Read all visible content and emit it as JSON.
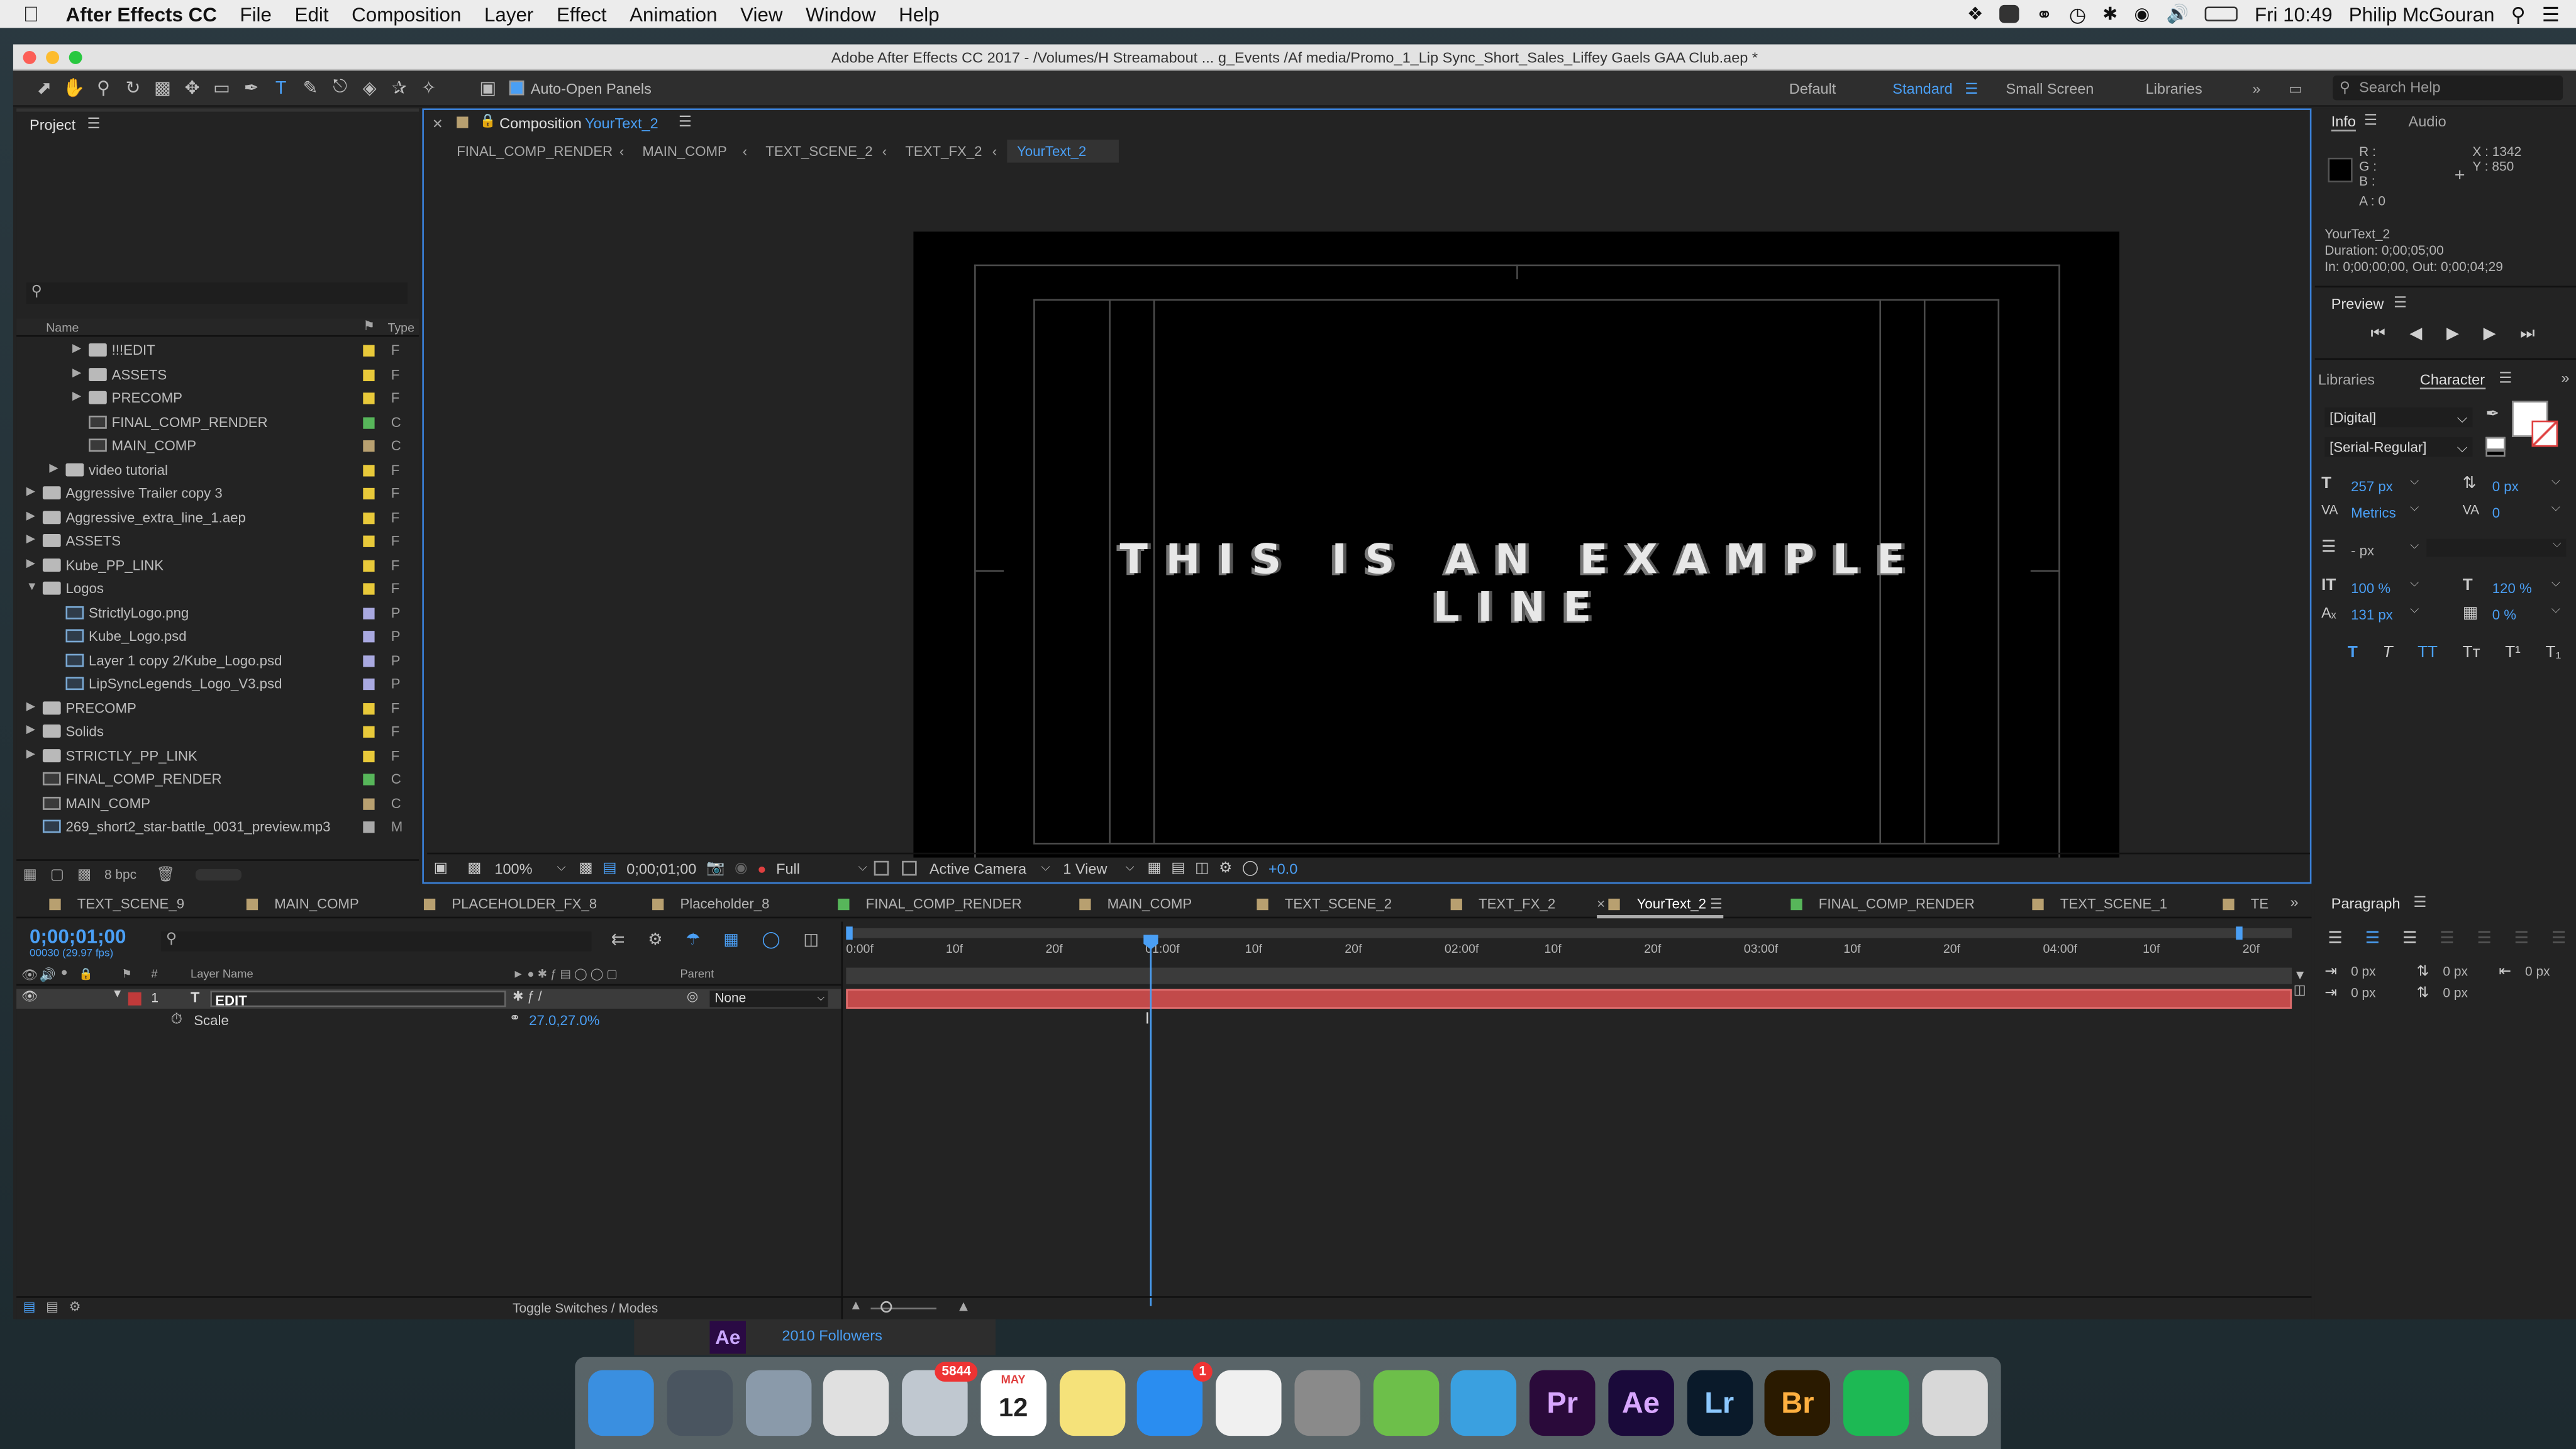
{
  "menubar": {
    "app": "After Effects CC",
    "items": [
      "File",
      "Edit",
      "Composition",
      "Layer",
      "Effect",
      "Animation",
      "View",
      "Window",
      "Help"
    ],
    "time": "Fri 10:49",
    "user": "Philip McGouran"
  },
  "window": {
    "title": "Adobe After Effects CC 2017 - /Volumes/H Streamabout ... g_Events /Af media/Promo_1_Lip Sync_Short_Sales_Liffey Gaels GAA Club.aep *"
  },
  "toolbar": {
    "auto_open": "Auto-Open Panels",
    "workspaces": [
      "Default",
      "Standard",
      "Small Screen",
      "Libraries"
    ],
    "current_workspace": "Standard",
    "search_placeholder": "Search Help"
  },
  "project": {
    "title": "Project",
    "search_placeholder": "",
    "col_name": "Name",
    "col_type": "Type",
    "bpc": "8 bpc",
    "items": [
      {
        "name": "!!!EDIT",
        "kind": "folder",
        "indent": 2,
        "tri": "▶",
        "color": "#e8c93a",
        "type": "F"
      },
      {
        "name": "ASSETS",
        "kind": "folder",
        "indent": 2,
        "tri": "▶",
        "color": "#e8c93a",
        "type": "F"
      },
      {
        "name": "PRECOMP",
        "kind": "folder",
        "indent": 2,
        "tri": "▶",
        "color": "#e8c93a",
        "type": "F"
      },
      {
        "name": "FINAL_COMP_RENDER",
        "kind": "comp",
        "indent": 2,
        "tri": "",
        "color": "#57b65a",
        "type": "C"
      },
      {
        "name": "MAIN_COMP",
        "kind": "comp",
        "indent": 2,
        "tri": "",
        "color": "#b8a070",
        "type": "C"
      },
      {
        "name": "video tutorial",
        "kind": "folder",
        "indent": 1,
        "tri": "▶",
        "color": "#e8c93a",
        "type": "F"
      },
      {
        "name": "Aggressive Trailer copy 3",
        "kind": "folder",
        "indent": 0,
        "tri": "▶",
        "color": "#e8c93a",
        "type": "F"
      },
      {
        "name": "Aggressive_extra_line_1.aep",
        "kind": "folder",
        "indent": 0,
        "tri": "▶",
        "color": "#e8c93a",
        "type": "F"
      },
      {
        "name": "ASSETS",
        "kind": "folder",
        "indent": 0,
        "tri": "▶",
        "color": "#e8c93a",
        "type": "F"
      },
      {
        "name": "Kube_PP_LINK",
        "kind": "folder",
        "indent": 0,
        "tri": "▶",
        "color": "#e8c93a",
        "type": "F"
      },
      {
        "name": "Logos",
        "kind": "folder",
        "indent": 0,
        "tri": "▼",
        "color": "#e8c93a",
        "type": "F"
      },
      {
        "name": "StrictlyLogo.png",
        "kind": "file",
        "indent": 1,
        "tri": "",
        "color": "#a9a9e0",
        "type": "P"
      },
      {
        "name": "Kube_Logo.psd",
        "kind": "file",
        "indent": 1,
        "tri": "",
        "color": "#a9a9e0",
        "type": "P"
      },
      {
        "name": "Layer 1 copy 2/Kube_Logo.psd",
        "kind": "file",
        "indent": 1,
        "tri": "",
        "color": "#a9a9e0",
        "type": "P"
      },
      {
        "name": "LipSyncLegends_Logo_V3.psd",
        "kind": "file",
        "indent": 1,
        "tri": "",
        "color": "#a9a9e0",
        "type": "P"
      },
      {
        "name": "PRECOMP",
        "kind": "folder",
        "indent": 0,
        "tri": "▶",
        "color": "#e8c93a",
        "type": "F"
      },
      {
        "name": "Solids",
        "kind": "folder",
        "indent": 0,
        "tri": "▶",
        "color": "#e8c93a",
        "type": "F"
      },
      {
        "name": "STRICTLY_PP_LINK",
        "kind": "folder",
        "indent": 0,
        "tri": "▶",
        "color": "#e8c93a",
        "type": "F"
      },
      {
        "name": "FINAL_COMP_RENDER",
        "kind": "comp",
        "indent": 0,
        "tri": "",
        "color": "#57b65a",
        "type": "C"
      },
      {
        "name": "MAIN_COMP",
        "kind": "comp",
        "indent": 0,
        "tri": "",
        "color": "#b8a070",
        "type": "C"
      },
      {
        "name": "269_short2_star-battle_0031_preview.mp3",
        "kind": "file",
        "indent": 0,
        "tri": "",
        "color": "#a9a9a9",
        "type": "M"
      }
    ]
  },
  "composition": {
    "tab_prefix": "Composition",
    "tab_name": "YourText_2",
    "breadcrumbs": [
      "FINAL_COMP_RENDER",
      "MAIN_COMP",
      "TEXT_SCENE_2",
      "TEXT_FX_2",
      "YourText_2"
    ],
    "canvas_text": "THIS IS AN EXAMPLE LINE",
    "zoom": "100%",
    "timecode": "0;00;01;00",
    "resolution": "Full",
    "camera": "Active Camera",
    "views": "1 View",
    "exposure": "+0.0"
  },
  "info": {
    "tab": "Info",
    "tab2": "Audio",
    "r": "R :",
    "g": "G :",
    "b": "B :",
    "a": "A : 0",
    "x": "X : 1342",
    "y": "Y : 850",
    "comp_name": "YourText_2",
    "duration": "Duration: 0;00;05;00",
    "inout": "In: 0;00;00;00, Out: 0;00;04;29"
  },
  "preview": {
    "title": "Preview"
  },
  "character": {
    "tab_lib": "Libraries",
    "tab": "Character",
    "font": "[Digital]",
    "style": "[Serial-Regular]",
    "size": "257 px",
    "leading": "0 px",
    "kerning": "Metrics",
    "tracking": "0",
    "stroke": "- px",
    "vscale": "100 %",
    "hscale": "120 %",
    "baseline": "131 px",
    "tsume": "0 %"
  },
  "paragraph": {
    "title": "Paragraph",
    "values": [
      "0 px",
      "0 px",
      "0 px",
      "0 px",
      "0 px"
    ]
  },
  "timeline": {
    "tabs": [
      {
        "name": "TEXT_SCENE_9",
        "color": "#b8a070"
      },
      {
        "name": "MAIN_COMP",
        "color": "#b8a070"
      },
      {
        "name": "PLACEHOLDER_FX_8",
        "color": "#b8a070"
      },
      {
        "name": "Placeholder_8",
        "color": "#b8a070"
      },
      {
        "name": "FINAL_COMP_RENDER",
        "color": "#57b65a"
      },
      {
        "name": "MAIN_COMP",
        "color": "#b8a070"
      },
      {
        "name": "TEXT_SCENE_2",
        "color": "#b8a070"
      },
      {
        "name": "TEXT_FX_2",
        "color": "#b8a070"
      },
      {
        "name": "YourText_2",
        "color": "#b8a070"
      },
      {
        "name": "FINAL_COMP_RENDER",
        "color": "#57b65a"
      },
      {
        "name": "TEXT_SCENE_1",
        "color": "#b8a070"
      },
      {
        "name": "TE",
        "color": "#b8a070"
      }
    ],
    "timecode": "0;00;01;00",
    "fps": "00030 (29.97 fps)",
    "search_placeholder": "",
    "col_layer": "Layer Name",
    "col_num": "#",
    "col_parent": "Parent",
    "layer": {
      "num": "1",
      "name": "EDIT",
      "parent": "None",
      "color": "#c03a3a"
    },
    "prop": {
      "name": "Scale",
      "value": "27.0,27.0%"
    },
    "ruler": [
      "0:00f",
      "10f",
      "20f",
      "01:00f",
      "10f",
      "20f",
      "02:00f",
      "10f",
      "20f",
      "03:00f",
      "10f",
      "20f",
      "04:00f",
      "10f",
      "20f"
    ],
    "toggle": "Toggle Switches / Modes",
    "playhead_fraction": 0.2
  },
  "notification": {
    "followers": "2010 Followers",
    "badge": "Ae"
  },
  "dock": {
    "items": [
      {
        "name": "finder",
        "label": "",
        "color": "#3a8fe0"
      },
      {
        "name": "preview",
        "label": "",
        "color": "#4a5560"
      },
      {
        "name": "launchpad",
        "label": "",
        "color": "#8a9aaa"
      },
      {
        "name": "chrome",
        "label": "",
        "color": "#e0e0e0"
      },
      {
        "name": "mail",
        "label": "",
        "color": "#c0c8d0",
        "badge": "5844"
      },
      {
        "name": "calendar",
        "label": "12",
        "color": "#ffffff",
        "sub": "MAY"
      },
      {
        "name": "notes",
        "label": "",
        "color": "#f5e27a"
      },
      {
        "name": "app-store",
        "label": "",
        "color": "#2a8df0",
        "badge": "1"
      },
      {
        "name": "photos",
        "label": "",
        "color": "#f0f0f0"
      },
      {
        "name": "system-preferences",
        "label": "",
        "color": "#8a8a8a"
      },
      {
        "name": "apps1",
        "label": "",
        "color": "#6dbf4a"
      },
      {
        "name": "apps2",
        "label": "",
        "color": "#3aa0e0"
      },
      {
        "name": "premiere",
        "label": "Pr",
        "color": "#2a0a3a"
      },
      {
        "name": "after-effects",
        "label": "Ae",
        "color": "#1a0a3a"
      },
      {
        "name": "lightroom",
        "label": "Lr",
        "color": "#0a1a2a"
      },
      {
        "name": "bridge",
        "label": "Br",
        "color": "#2a1a00"
      },
      {
        "name": "spotify",
        "label": "",
        "color": "#1db954"
      },
      {
        "name": "trash",
        "label": "",
        "color": "#d8d8d8"
      }
    ]
  },
  "colors": {
    "accent": "#4a9ff5",
    "layer_bar": "#c24a4a"
  }
}
